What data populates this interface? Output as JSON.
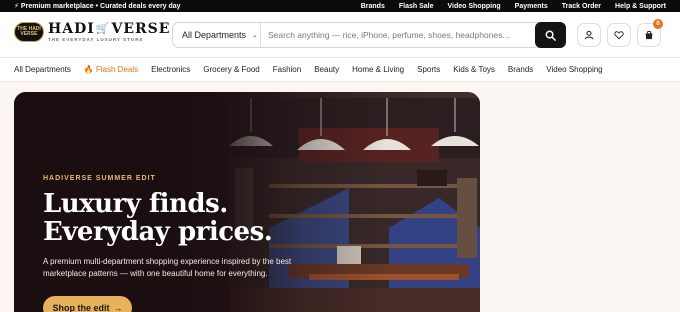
{
  "topbar": {
    "promo": "Premium marketplace • Curated deals every day",
    "links": [
      "Brands",
      "Flash Sale",
      "Video Shopping",
      "Payments",
      "Track Order",
      "Help & Support"
    ]
  },
  "logo": {
    "badge": "THE HADI VERSE",
    "title_left": "HADI",
    "title_right": "VERSE",
    "tagline": "THE EVERYDAY LUXURY STORE"
  },
  "search": {
    "department": "All Departments",
    "placeholder": "Search anything — rice, iPhone, perfume, shoes, headphones..."
  },
  "cart": {
    "count": "0"
  },
  "nav": {
    "items": [
      "All Departments",
      "Flash Deals",
      "Electronics",
      "Grocery & Food",
      "Fashion",
      "Beauty",
      "Home & Living",
      "Sports",
      "Kids & Toys",
      "Brands",
      "Video Shopping"
    ]
  },
  "hero": {
    "eyebrow": "HADIVERSE SUMMER EDIT",
    "headline_line1": "Luxury finds.",
    "headline_line2": "Everyday prices.",
    "subtitle": "A premium multi-department shopping experience inspired by the best marketplace patterns — with one beautiful home for everything.",
    "cta": "Shop the edit"
  },
  "colors": {
    "accent": "#e2761b",
    "cta": "#e8b15c",
    "hero_bg": "#1c0f12",
    "topbar_bg": "#0b0b0b"
  }
}
